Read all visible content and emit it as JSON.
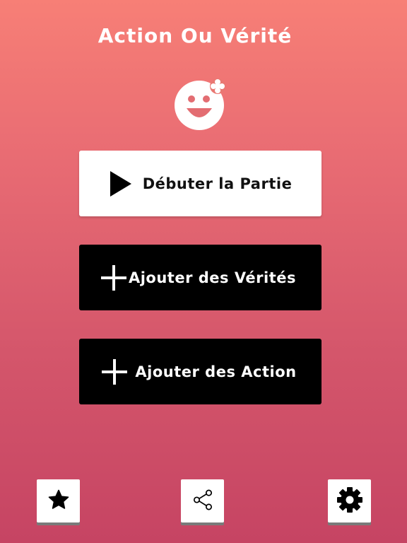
{
  "app": {
    "title": "Action Ou Vérité"
  },
  "logo": {
    "icon": "smiley-face-icon"
  },
  "menu": {
    "start_label": "Débuter la Partie",
    "start_icon": "play-icon",
    "add_truths_label": "Ajouter des Vérités",
    "add_truths_icon": "plus-icon",
    "add_actions_label": "Ajouter des Action",
    "add_actions_icon": "plus-icon"
  },
  "bottom_bar": {
    "favorites_icon": "star-icon",
    "share_icon": "share-icon",
    "settings_icon": "gear-icon"
  },
  "colors": {
    "background_top": "#f77f76",
    "background_bottom": "#c64463",
    "primary_button": "#ffffff",
    "secondary_button": "#000000"
  }
}
